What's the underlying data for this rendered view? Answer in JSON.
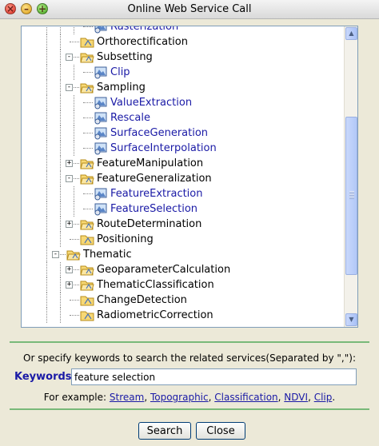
{
  "window": {
    "title": "Online Web Service Call"
  },
  "tree": {
    "items": [
      {
        "label": "Rasterization",
        "level": 3,
        "type": "service",
        "link": true
      },
      {
        "label": "Orthorectification",
        "level": 2,
        "type": "folder",
        "link": false
      },
      {
        "label": "Subsetting",
        "level": 2,
        "type": "folder-open",
        "link": false,
        "expander": "-"
      },
      {
        "label": "Clip",
        "level": 3,
        "type": "service",
        "link": true
      },
      {
        "label": "Sampling",
        "level": 2,
        "type": "folder-open",
        "link": false,
        "expander": "-"
      },
      {
        "label": "ValueExtraction",
        "level": 3,
        "type": "service",
        "link": true
      },
      {
        "label": "Rescale",
        "level": 3,
        "type": "service",
        "link": true
      },
      {
        "label": "SurfaceGeneration",
        "level": 3,
        "type": "service",
        "link": true
      },
      {
        "label": "SurfaceInterpolation",
        "level": 3,
        "type": "service",
        "link": true
      },
      {
        "label": "FeatureManipulation",
        "level": 2,
        "type": "folder-open",
        "link": false,
        "expander": "+"
      },
      {
        "label": "FeatureGeneralization",
        "level": 2,
        "type": "folder-open",
        "link": false,
        "expander": "-"
      },
      {
        "label": "FeatureExtraction",
        "level": 3,
        "type": "service",
        "link": true
      },
      {
        "label": "FeatureSelection",
        "level": 3,
        "type": "service",
        "link": true
      },
      {
        "label": "RouteDetermination",
        "level": 2,
        "type": "folder-open",
        "link": false,
        "expander": "+"
      },
      {
        "label": "Positioning",
        "level": 2,
        "type": "folder",
        "link": false
      },
      {
        "label": "Thematic",
        "level": 1,
        "type": "folder-open",
        "link": false,
        "expander": "-"
      },
      {
        "label": "GeoparameterCalculation",
        "level": 2,
        "type": "folder-open",
        "link": false,
        "expander": "+"
      },
      {
        "label": "ThematicClassification",
        "level": 2,
        "type": "folder-open",
        "link": false,
        "expander": "+"
      },
      {
        "label": "ChangeDetection",
        "level": 2,
        "type": "folder",
        "link": false
      },
      {
        "label": "RadiometricCorrection",
        "level": 2,
        "type": "folder",
        "link": false
      }
    ]
  },
  "search": {
    "hint": "Or specify keywords to search the related services(Separated by \",\"):",
    "keywords_label": "Keywords:",
    "keywords_value": "feature selection",
    "example_prefix": "For example:",
    "examples": [
      "Stream",
      "Topographic",
      "Classification",
      "NDVI",
      "Clip"
    ]
  },
  "buttons": {
    "search": "Search",
    "close": "Close"
  },
  "colors": {
    "link": "#1a1aa6",
    "separator": "#79b979",
    "window_bg": "#ece9d8"
  }
}
